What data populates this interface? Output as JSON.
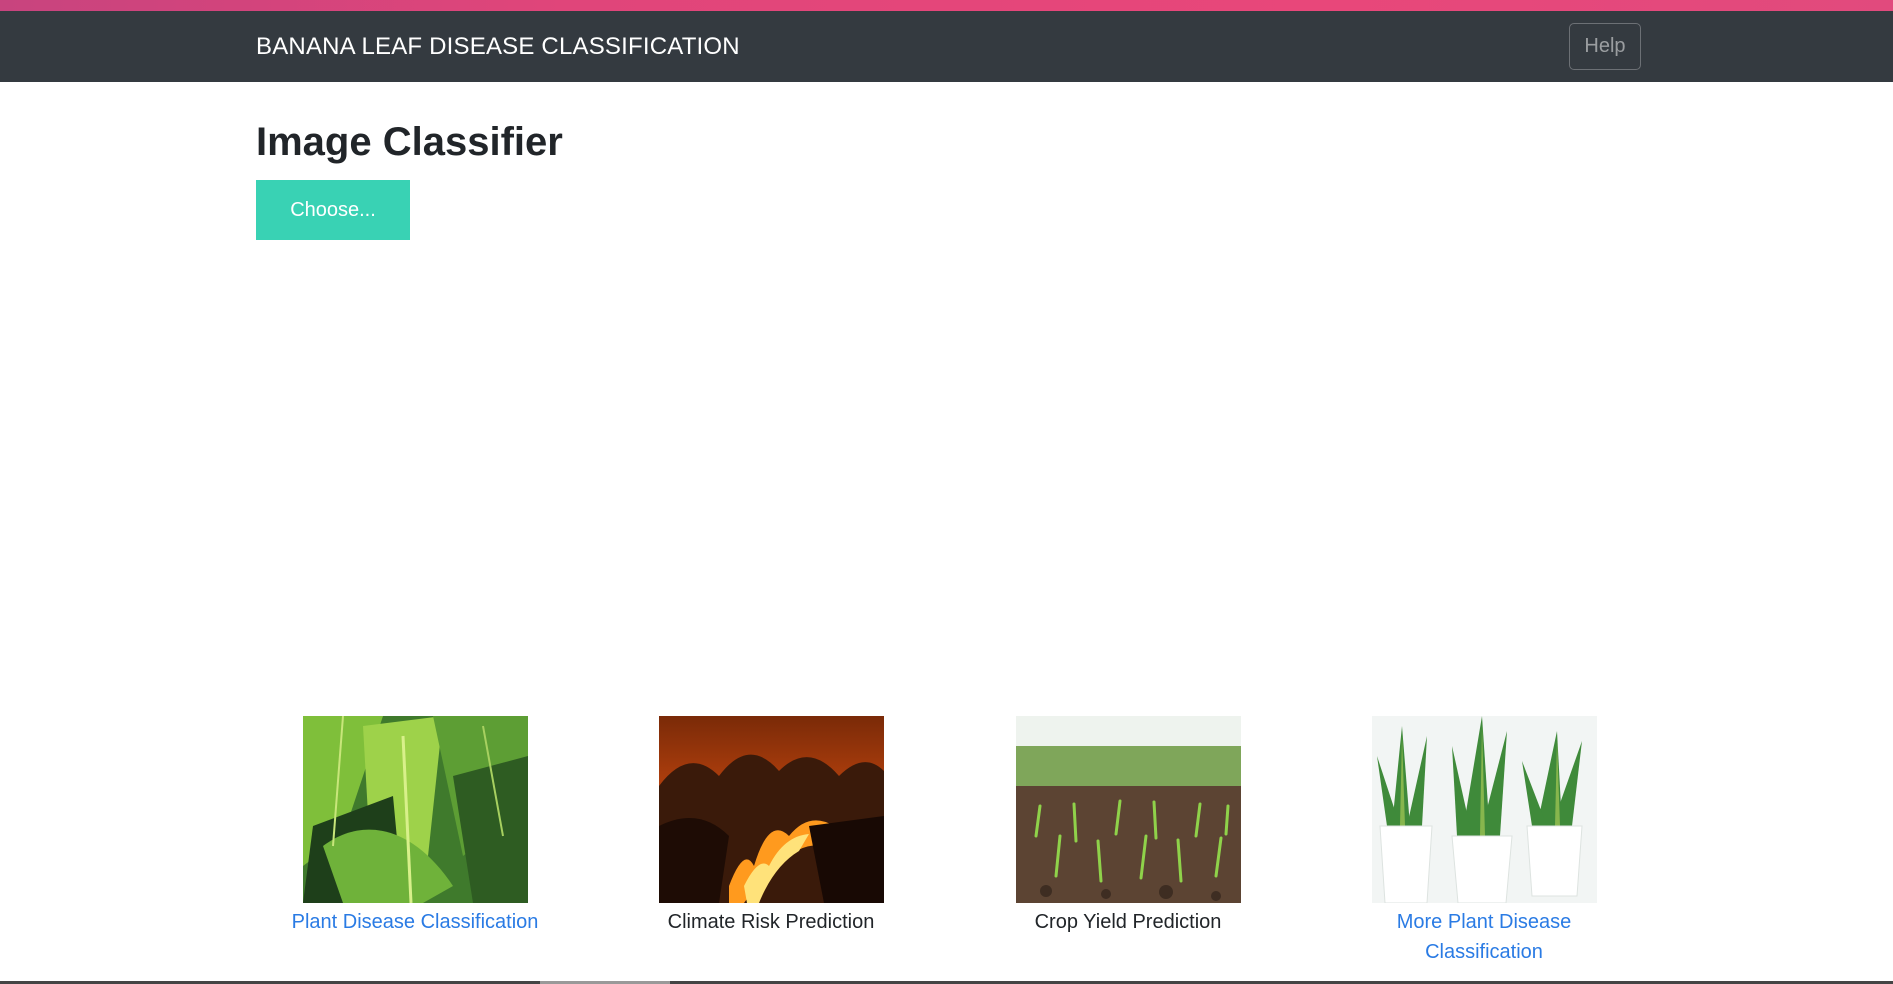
{
  "navbar": {
    "brand": "BANANA LEAF DISEASE CLASSIFICATION",
    "help_label": "Help"
  },
  "main": {
    "title": "Image Classifier",
    "choose_label": "Choose..."
  },
  "cards": [
    {
      "label": "Plant Disease Classification",
      "is_link": true,
      "image": "banana-leaves-image"
    },
    {
      "label": "Climate Risk Prediction",
      "is_link": false,
      "image": "forest-fire-image"
    },
    {
      "label": "Crop Yield Prediction",
      "is_link": false,
      "image": "crop-seedlings-image"
    },
    {
      "label": "More Plant Disease Classification",
      "is_link": true,
      "image": "potted-plants-image"
    }
  ],
  "colors": {
    "navbar_bg": "#343a40",
    "accent_button": "#39d2b4",
    "link": "#2a7be4",
    "gradient_bar": "#e0457a"
  }
}
